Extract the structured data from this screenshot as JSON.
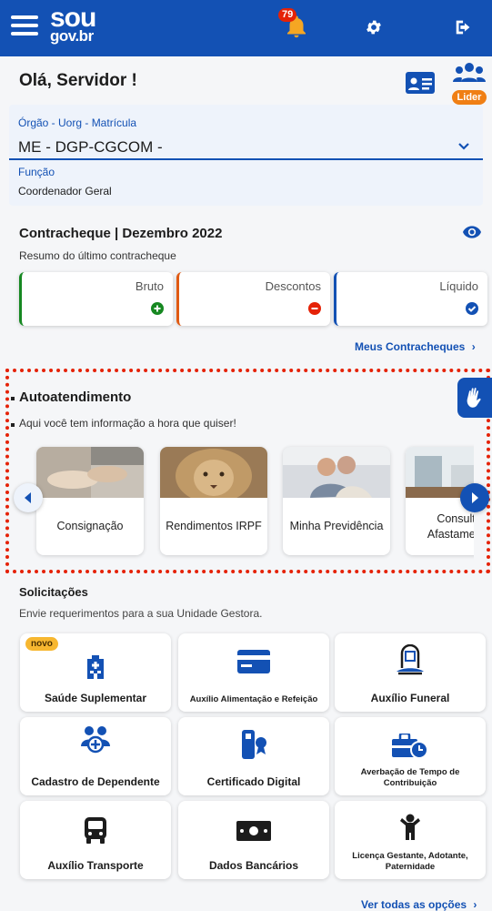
{
  "header": {
    "logo_top": "sou",
    "logo_bottom": "gov.br",
    "notifications_count": "79"
  },
  "greeting": {
    "text": "Olá, Servidor !",
    "leader_tag": "Lider"
  },
  "org": {
    "label": "Órgão - Uorg - Matrícula",
    "value": "ME - DGP-CGCOM -",
    "function_label": "Função",
    "function_value": "Coordenador Geral"
  },
  "paycheck": {
    "title": "Contracheque | Dezembro 2022",
    "subtitle": "Resumo do último contracheque",
    "cards": [
      {
        "label": "Bruto",
        "color": "#168821"
      },
      {
        "label": "Descontos",
        "color": "#e52207"
      },
      {
        "label": "Líquido",
        "color": "#1351b4"
      }
    ],
    "more_link": "Meus Contracheques"
  },
  "self_service": {
    "title": "Autoatendimento",
    "subtitle": "Aqui você tem informação a hora que quiser!",
    "items": [
      {
        "label": "Consignação"
      },
      {
        "label": "Rendimentos IRPF"
      },
      {
        "label": "Minha Previdência"
      },
      {
        "label": "Consulta Afastamento"
      }
    ]
  },
  "requests": {
    "title": "Solicitações",
    "subtitle": "Envie requerimentos para a sua Unidade Gestora.",
    "new_tag": "novo",
    "items": [
      {
        "label": "Saúde Suplementar",
        "icon": "hospital-icon"
      },
      {
        "label": "Auxílio Alimentação e Refeição",
        "icon": "card-icon"
      },
      {
        "label": "Auxílio Funeral",
        "icon": "tombstone-icon"
      },
      {
        "label": "Cadastro de Dependente",
        "icon": "family-icon"
      },
      {
        "label": "Certificado Digital",
        "icon": "certificate-icon"
      },
      {
        "label": "Averbação de Tempo de Contribuição",
        "icon": "briefcase-clock-icon"
      },
      {
        "label": "Auxílio Transporte",
        "icon": "bus-icon"
      },
      {
        "label": "Dados Bancários",
        "icon": "money-icon"
      },
      {
        "label": "Licença Gestante, Adotante, Paternidade",
        "icon": "child-icon"
      }
    ],
    "more_link": "Ver todas as opções"
  },
  "colors": {
    "primary": "#1351b4",
    "danger": "#e52207",
    "success": "#168821",
    "orange": "#f07f14"
  }
}
